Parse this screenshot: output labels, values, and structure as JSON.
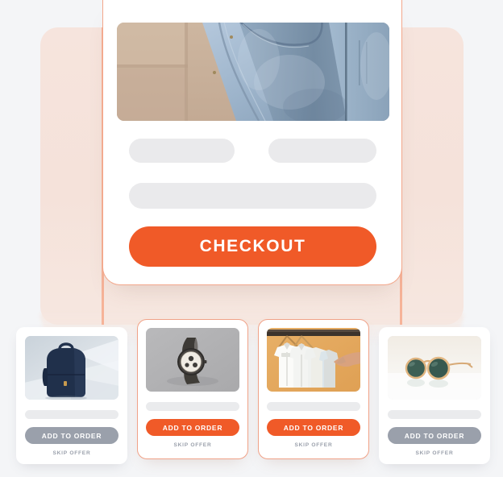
{
  "theme": {
    "page_background": "#f4f5f7",
    "panel_background": "#f5e2da",
    "accent": "#f05a28",
    "accent_border": "#f0a288",
    "muted_button": "#9aa0ab",
    "skeleton": "#eaeaec"
  },
  "checkout": {
    "hero_image_alt": "denim-jeans-photo",
    "skeleton_fields": [
      "field-left",
      "field-right",
      "field-full"
    ],
    "button_label": "CHECKOUT"
  },
  "offers": {
    "add_label": "ADD TO ORDER",
    "skip_label": "SKIP OFFER",
    "items": [
      {
        "image_alt": "navy-backpack-photo",
        "selected": false,
        "add_label": "ADD TO ORDER",
        "skip_label": "SKIP OFFER"
      },
      {
        "image_alt": "chronograph-watch-photo",
        "selected": true,
        "add_label": "ADD TO ORDER",
        "skip_label": "SKIP OFFER"
      },
      {
        "image_alt": "white-shirts-on-hangers-photo",
        "selected": true,
        "add_label": "ADD TO ORDER",
        "skip_label": "SKIP OFFER"
      },
      {
        "image_alt": "round-sunglasses-photo",
        "selected": false,
        "add_label": "ADD TO ORDER",
        "skip_label": "SKIP OFFER"
      }
    ]
  }
}
